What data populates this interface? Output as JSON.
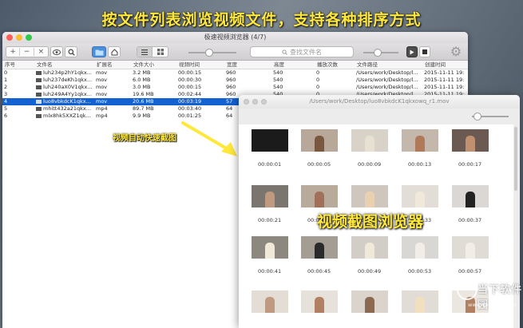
{
  "banner": "按文件列表浏览视频文件，支持各种排序方式",
  "window": {
    "title": "极速视频浏览器 (4/7)"
  },
  "toolbar": {
    "add": "+",
    "remove": "−",
    "clear": "×",
    "search_placeholder": "查找文件名"
  },
  "table": {
    "columns": [
      "序号",
      "文件名",
      "扩展名",
      "文件大小",
      "视频时间",
      "宽度",
      "高度",
      "播放次数",
      "文件路径",
      "创建时间"
    ],
    "rows": [
      [
        "0",
        "luh234p2hY1qkx...",
        "mov",
        "3.2 MB",
        "00:00:15",
        "960",
        "540",
        "0",
        "/Users/work/Desktop/l...",
        "2015-11-11 19:"
      ],
      [
        "1",
        "luh237deKh1qkx...",
        "mov",
        "6.0 MB",
        "00:00:30",
        "960",
        "540",
        "0",
        "/Users/work/Desktop/l...",
        "2015-11-11 19:"
      ],
      [
        "2",
        "luh240aX0V1qkx...",
        "mov",
        "3.0 MB",
        "00:00:15",
        "960",
        "540",
        "0",
        "/Users/work/Desktop/l...",
        "2015-11-11 19:"
      ],
      [
        "3",
        "luh249A4Yy1qkx...",
        "mov",
        "19.6 MB",
        "00:02:44",
        "960",
        "540",
        "0",
        "/Users/work/Desktop/l...",
        "2015-11-11 19:"
      ],
      [
        "4",
        "luo8vbkdcK1qkx...",
        "mov",
        "20.6 MB",
        "00:03:19",
        "57",
        "",
        "",
        "",
        ""
      ],
      [
        "5",
        "mhitt432a21qkx...",
        "mp4",
        "89.7 MB",
        "00:03:40",
        "64",
        "",
        "",
        "",
        ""
      ],
      [
        "6",
        "mlx8hk5XXZ1qk...",
        "mp4",
        "9.9 MB",
        "00:01:25",
        "64",
        "",
        "",
        "",
        ""
      ]
    ],
    "selected_row": 4
  },
  "annotation_small": "视频自动快速截图",
  "viewer": {
    "path": "/Users/work/Desktop/luo8vbkdcK1qkxowq_r1.mov",
    "label": "视频截图浏览器",
    "timestamps": [
      "00:00:01",
      "00:00:05",
      "00:00:09",
      "00:00:13",
      "00:00:17",
      "00:00:21",
      "00:00:25",
      "00:00:29",
      "00:00:33",
      "00:00:37",
      "00:00:41",
      "00:00:45",
      "00:00:49",
      "00:00:53",
      "00:00:57",
      "",
      "",
      "",
      "",
      ""
    ]
  },
  "watermark": {
    "text": "当下软件园",
    "url": "www.downxia.com"
  }
}
